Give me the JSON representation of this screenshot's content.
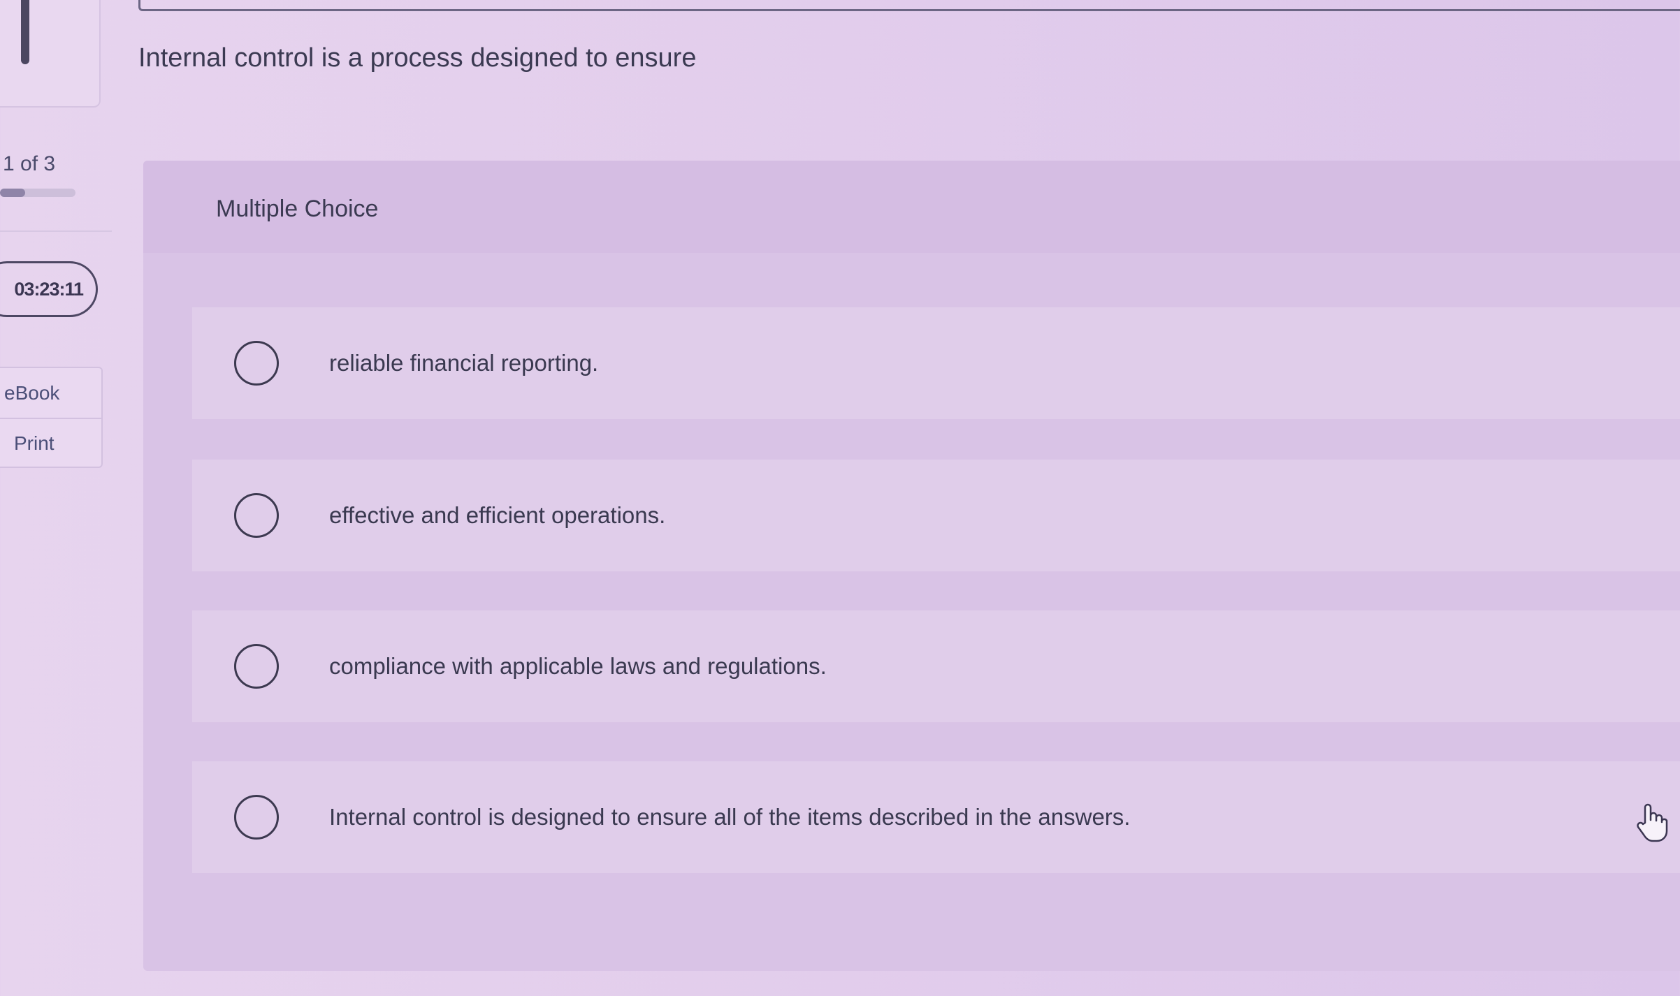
{
  "sidebar": {
    "question_counter": "1 of 3",
    "progress_fraction": 0.333,
    "timer": "03:23:11",
    "links": [
      {
        "label": "eBook"
      },
      {
        "label": "Print"
      }
    ]
  },
  "question": {
    "prompt": "Internal control is a process designed to ensure",
    "type_label": "Multiple Choice",
    "choices": [
      {
        "text": "reliable financial reporting."
      },
      {
        "text": "effective and efficient operations."
      },
      {
        "text": "compliance with applicable laws and regulations."
      },
      {
        "text": "Internal control is designed to ensure all of the items described in the answers."
      }
    ]
  },
  "icons": {
    "cursor": "hand-pointer-icon"
  },
  "colors": {
    "background": "#e2cdec",
    "panel": "#d9c3e6",
    "choice_row": "#e0cdea",
    "text": "#3b3a52"
  }
}
